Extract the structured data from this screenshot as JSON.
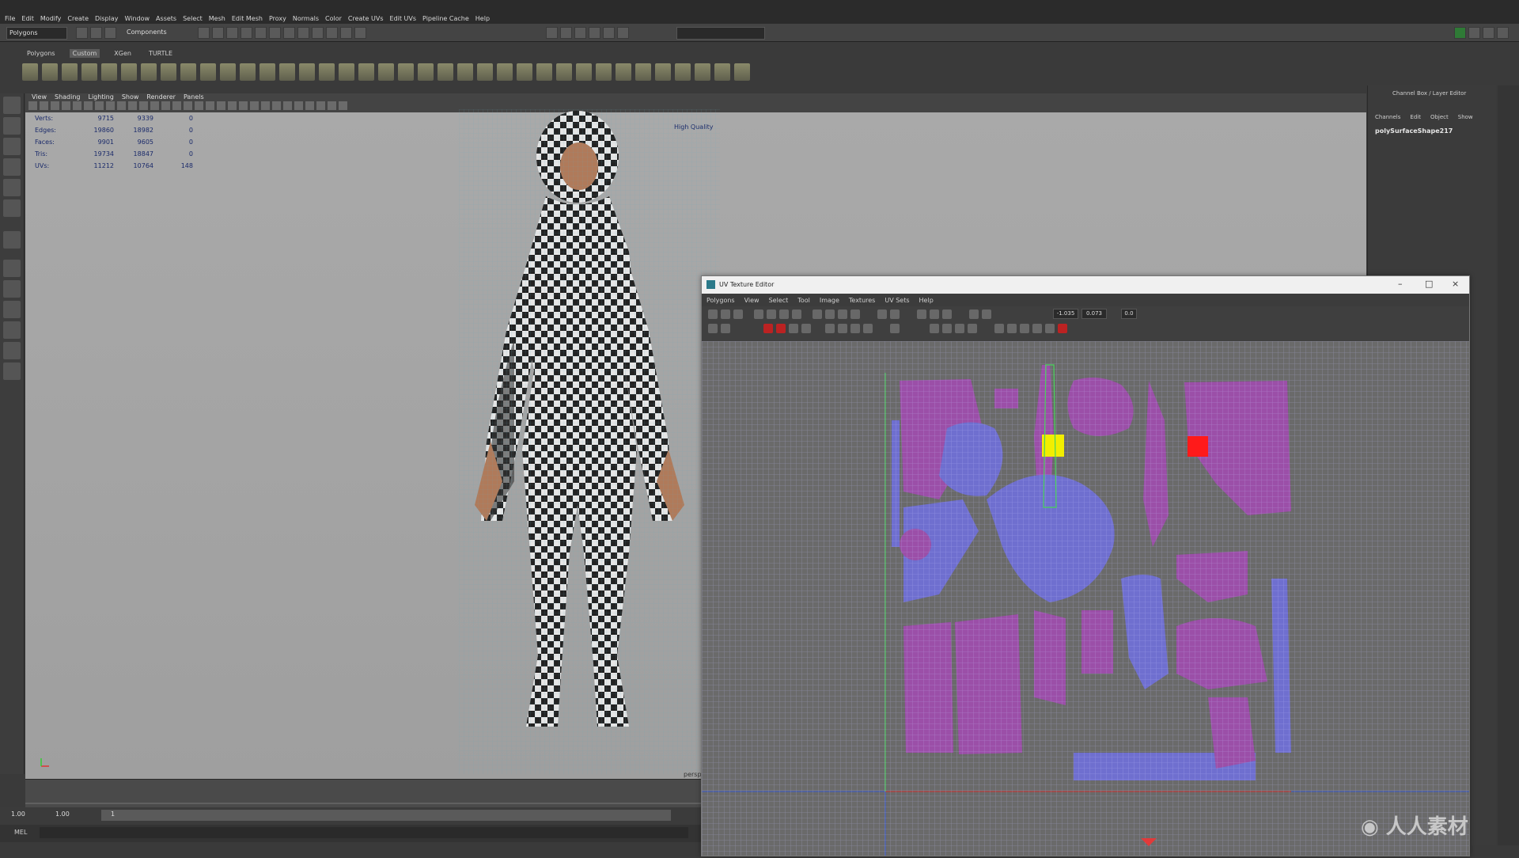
{
  "menubar": {
    "items": [
      "File",
      "Edit",
      "Modify",
      "Create",
      "Display",
      "Window",
      "Assets",
      "Select",
      "Mesh",
      "Edit Mesh",
      "Proxy",
      "Normals",
      "Color",
      "Create UVs",
      "Edit UVs",
      "Pipeline Cache",
      "Help"
    ]
  },
  "status_line": {
    "mode": "Polygons",
    "selection_mode": "Components"
  },
  "shelf": {
    "tabs": [
      "Polygons",
      "Custom",
      "XGen",
      "TURTLE"
    ],
    "active_tab": "Custom"
  },
  "viewport": {
    "menu": [
      "View",
      "Shading",
      "Lighting",
      "Show",
      "Renderer",
      "Panels"
    ],
    "hud": {
      "rows": [
        {
          "label": "Verts:",
          "a": "9715",
          "b": "9339",
          "c": "0"
        },
        {
          "label": "Edges:",
          "a": "19860",
          "b": "18982",
          "c": "0"
        },
        {
          "label": "Faces:",
          "a": "9901",
          "b": "9605",
          "c": "0"
        },
        {
          "label": "Tris:",
          "a": "19734",
          "b": "18847",
          "c": "0"
        },
        {
          "label": "UVs:",
          "a": "11212",
          "b": "10764",
          "c": "148"
        }
      ],
      "quality": "High Quality"
    },
    "camera_label": "persp"
  },
  "channel_box": {
    "title": "Channel Box / Layer Editor",
    "tabs": [
      "Channels",
      "Edit",
      "Object",
      "Show"
    ],
    "object_name": "polySurfaceShape217"
  },
  "time_range": {
    "start": "1.00",
    "end": "1.00",
    "current": "1"
  },
  "mel_label": "MEL",
  "uv_editor": {
    "title": "UV Texture Editor",
    "menu": [
      "Polygons",
      "View",
      "Select",
      "Tool",
      "Image",
      "Textures",
      "UV Sets",
      "Help"
    ],
    "field_u": "-1.035",
    "field_v": "0.073",
    "field_extra": "0.0"
  },
  "colors": {
    "accent_uv_purple": "#9b4fa8",
    "uv_wire": "#c8c8ff",
    "selected_yellow": "#f2ee00",
    "selected_red": "#ff1a1a",
    "uv_green": "#49d35b"
  }
}
